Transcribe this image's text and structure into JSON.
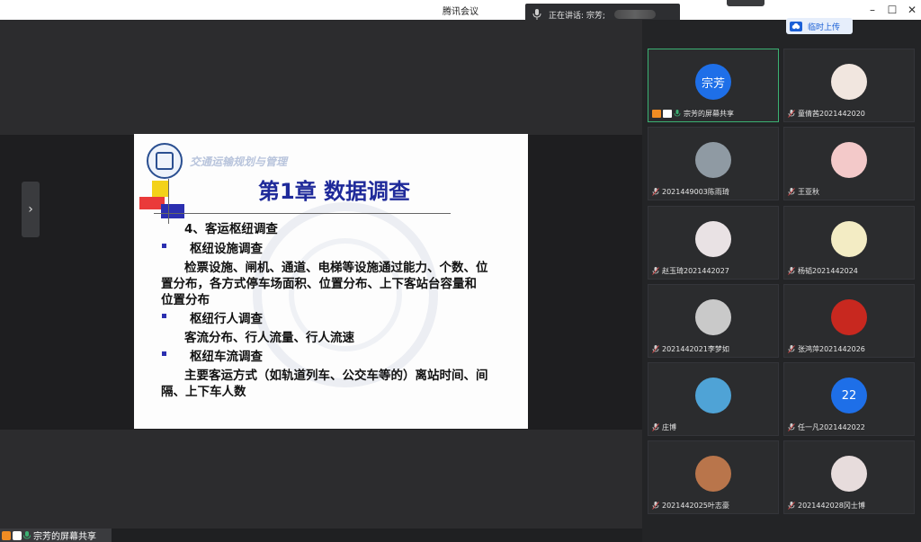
{
  "window": {
    "title": "腾讯会议",
    "minimize": "–",
    "maximize": "☐",
    "close": "✕",
    "speaking_label": "正在讲话: 宗芳;"
  },
  "toolbar": {
    "upload_label": "临时上传"
  },
  "main": {
    "expand_icon": "›"
  },
  "slide": {
    "course_title": "交通运输规划与管理",
    "chapter_title": "第1章 数据调查",
    "lines": [
      "4、客运枢纽调查",
      "枢纽设施调查",
      "检票设施、闸机、通道、电梯等设施通过能力、个数、位",
      "置分布，各方式停车场面积、位置分布、上下客站台容量和",
      "位置分布",
      "枢纽行人调查",
      "客流分布、行人流量、行人流速",
      "枢纽车流调查",
      "主要客运方式（如轨道列车、公交车等的）离站时间、间",
      "隔、上下车人数"
    ]
  },
  "share_badge": {
    "label": "宗芳的屏幕共享"
  },
  "participants": [
    {
      "name": "宗芳的屏幕共享",
      "avatar_text": "宗芳",
      "avatar_color": "#1e6fe8"
    },
    {
      "name": "童倩茜2021442020",
      "avatar_text": "",
      "avatar_color": "#f1e6df"
    },
    {
      "name": "2021449003陈雨琦",
      "avatar_text": "",
      "avatar_color": "#8f9aa3"
    },
    {
      "name": "王亚秋",
      "avatar_text": "",
      "avatar_color": "#f3c9c9"
    },
    {
      "name": "赵玉琦2021442027",
      "avatar_text": "",
      "avatar_color": "#e9e2e4"
    },
    {
      "name": "杨韬2021442024",
      "avatar_text": "",
      "avatar_color": "#f3ecc4"
    },
    {
      "name": "2021442021李梦如",
      "avatar_text": "",
      "avatar_color": "#c9c9c9"
    },
    {
      "name": "张鸿萍2021442026",
      "avatar_text": "",
      "avatar_color": "#c8281f"
    },
    {
      "name": "庄博",
      "avatar_text": "",
      "avatar_color": "#4fa3d6"
    },
    {
      "name": "任一凡2021442022",
      "avatar_text": "22",
      "avatar_color": "#1e6fe8"
    },
    {
      "name": "2021442025叶志豪",
      "avatar_text": "",
      "avatar_color": "#b9754b"
    },
    {
      "name": "2021442028冈士博",
      "avatar_text": "",
      "avatar_color": "#e7dcdc"
    }
  ]
}
